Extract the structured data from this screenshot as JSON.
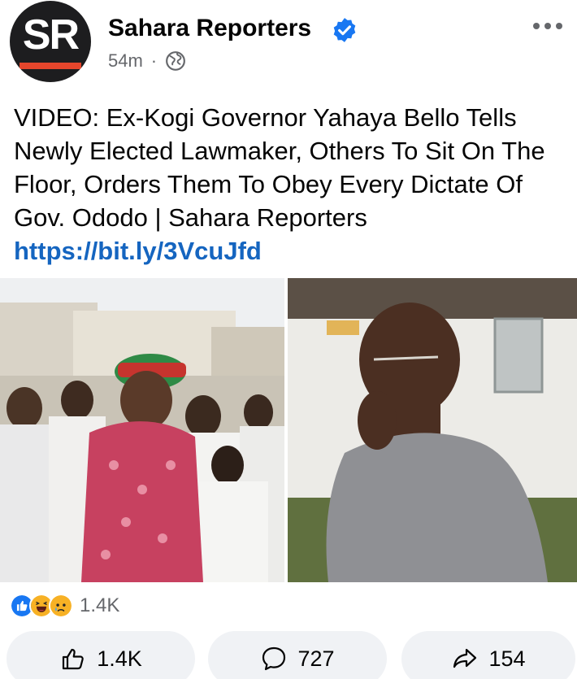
{
  "post": {
    "page_name": "Sahara Reporters",
    "avatar_initials": "SR",
    "time_ago": "54m",
    "separator": "·",
    "privacy_icon": "globe-icon",
    "more_icon": "more-dots-icon",
    "verified_icon": "verified-badge-icon",
    "caption": "VIDEO: Ex-Kogi Governor Yahaya Bello Tells Newly Elected Lawmaker, Others To Sit On The Floor, Orders Them To Obey Every Dictate Of Gov. Ododo | Sahara Reporters",
    "link": "https://bit.ly/3VcuJfd"
  },
  "reactions": {
    "icons": [
      "like-reaction-icon",
      "haha-reaction-icon",
      "sad-reaction-icon"
    ],
    "total": "1.4K"
  },
  "actions": {
    "like_count": "1.4K",
    "comment_count": "727",
    "share_count": "154"
  },
  "colors": {
    "link": "#1565c0",
    "verified": "#1877f2",
    "avatar_bg": "#1d1d1f",
    "avatar_stripe": "#e5462c",
    "muted_text": "#65676b",
    "button_bg": "#f0f2f5"
  }
}
